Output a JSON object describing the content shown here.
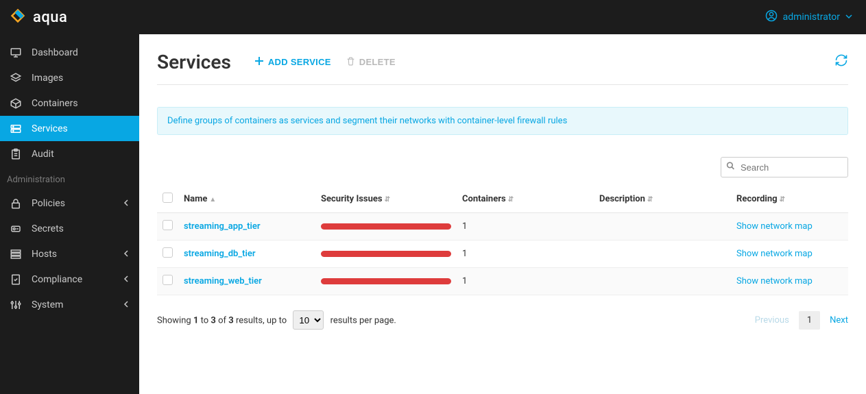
{
  "brand": {
    "name": "aqua"
  },
  "user": {
    "name": "administrator"
  },
  "sidebar": {
    "main_items": [
      {
        "label": "Dashboard",
        "icon": "monitor"
      },
      {
        "label": "Images",
        "icon": "layers"
      },
      {
        "label": "Containers",
        "icon": "box"
      },
      {
        "label": "Services",
        "icon": "server",
        "active": true
      },
      {
        "label": "Audit",
        "icon": "clipboard"
      }
    ],
    "admin_title": "Administration",
    "admin_items": [
      {
        "label": "Policies",
        "icon": "lock",
        "expandable": true
      },
      {
        "label": "Secrets",
        "icon": "key"
      },
      {
        "label": "Hosts",
        "icon": "hosts",
        "expandable": true
      },
      {
        "label": "Compliance",
        "icon": "check-doc",
        "expandable": true
      },
      {
        "label": "System",
        "icon": "sliders",
        "expandable": true
      }
    ]
  },
  "page": {
    "title": "Services",
    "add_label": "ADD SERVICE",
    "delete_label": "DELETE",
    "banner": "Define groups of containers as services and segment their networks with container-level firewall rules"
  },
  "search": {
    "placeholder": "Search"
  },
  "table": {
    "headers": {
      "name": "Name",
      "security": "Security Issues",
      "containers": "Containers",
      "description": "Description",
      "recording": "Recording"
    },
    "rows": [
      {
        "name": "streaming_app_tier",
        "containers": "1",
        "description": "",
        "recording": "Show network map"
      },
      {
        "name": "streaming_db_tier",
        "containers": "1",
        "description": "",
        "recording": "Show network map"
      },
      {
        "name": "streaming_web_tier",
        "containers": "1",
        "description": "",
        "recording": "Show network map"
      }
    ]
  },
  "pagination": {
    "showing_prefix": "Showing ",
    "from": "1",
    "to_word": " to ",
    "to": "3",
    "of_word": " of ",
    "total": "3",
    "suffix": " results, up to ",
    "per_page": "10",
    "suffix2": " results per page.",
    "previous": "Previous",
    "page": "1",
    "next": "Next"
  }
}
